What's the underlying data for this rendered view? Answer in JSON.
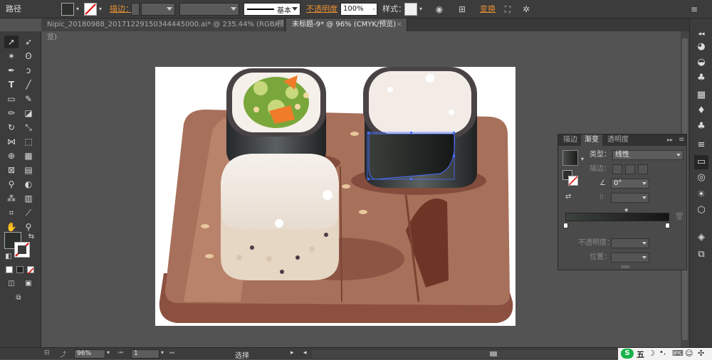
{
  "control_bar": {
    "selection_label": "路径",
    "stroke_label": "描边：",
    "profile_label": "基本",
    "opacity_label": "不透明度",
    "opacity_value": "100%",
    "style_label": "样式：",
    "transform_label": "变换"
  },
  "doc_tabs": [
    {
      "label": "Nipic_20180988_20171229150344445000.ai* @ 235.44% (RGB/预览)",
      "close": "×"
    },
    {
      "label": "未标题-9* @ 96% (CMYK/预览)",
      "close": "×"
    }
  ],
  "gradient_panel": {
    "tabs": [
      "描边",
      "渐变",
      "透明度"
    ],
    "type_label": "类型：",
    "type_value": "线性",
    "stroke_label": "描边：",
    "angle_value": "0°",
    "opacity_label": "不透明度：",
    "location_label": "位置："
  },
  "status_bar": {
    "zoom": "96%",
    "page": "1",
    "tool_status": "选择"
  },
  "system_tray": {
    "ime_label": "五"
  }
}
